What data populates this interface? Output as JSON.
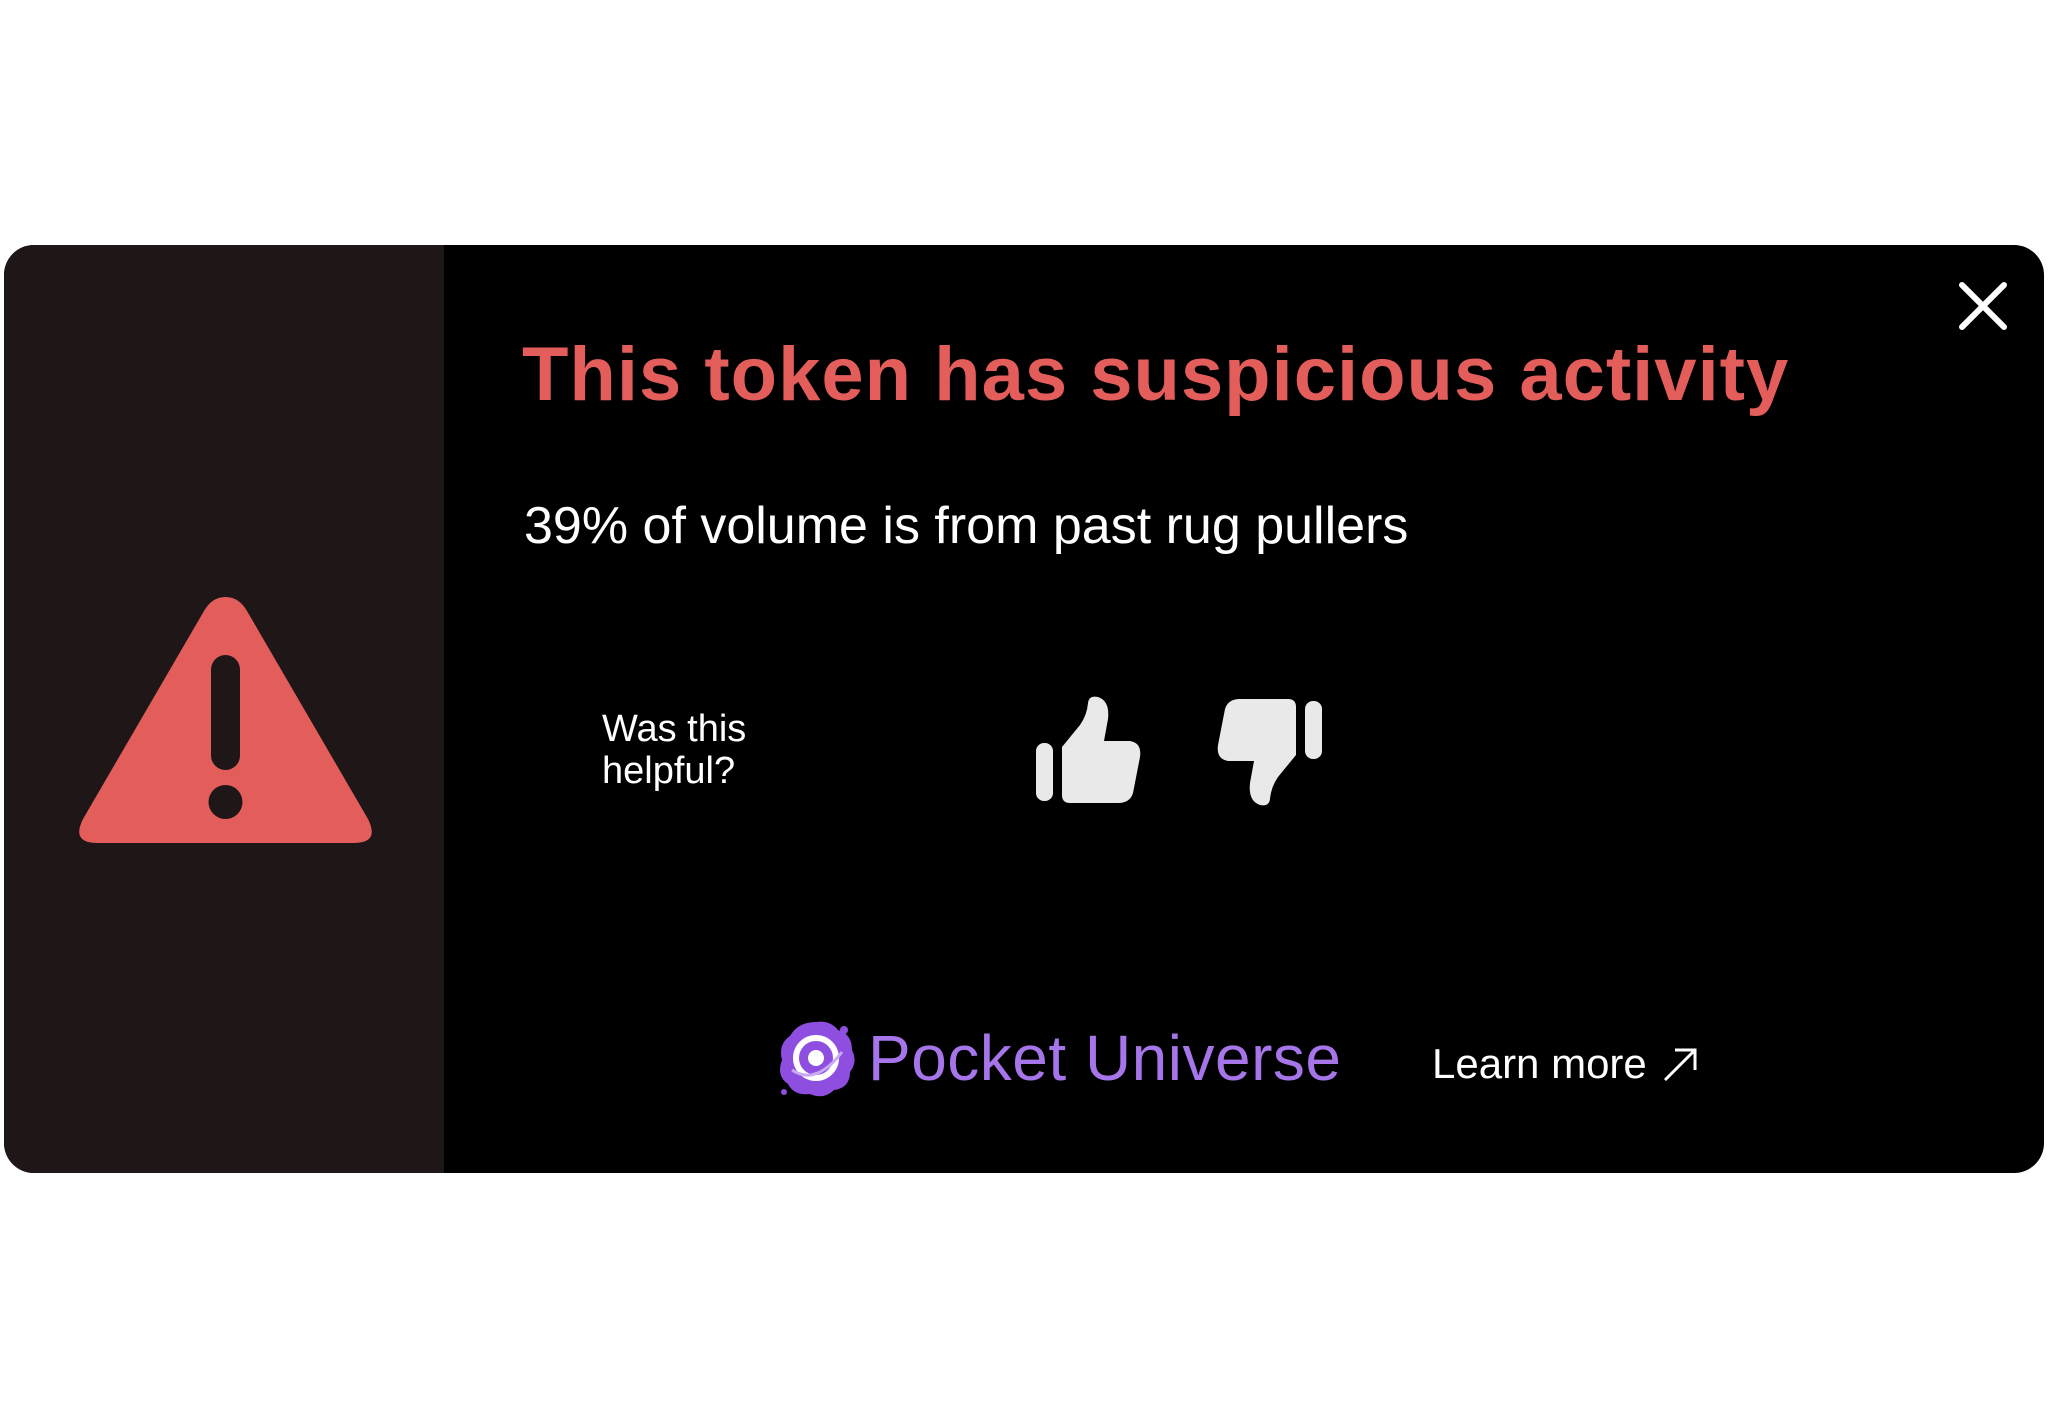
{
  "alert": {
    "title": "This token has suspicious activity",
    "message": "39% of volume is from past rug pullers",
    "icon": "warning-triangle-icon",
    "accent_color": "#e35d5b",
    "side_panel_color": "#1e1617"
  },
  "feedback": {
    "prompt": "Was this helpful?",
    "thumbs_up_icon": "thumbs-up-icon",
    "thumbs_down_icon": "thumbs-down-icon"
  },
  "footer": {
    "brand_name": "Pocket Universe",
    "brand_color": "#a775ea",
    "learn_more_label": "Learn more",
    "learn_more_icon": "external-arrow-icon"
  },
  "close_icon": "close-icon"
}
